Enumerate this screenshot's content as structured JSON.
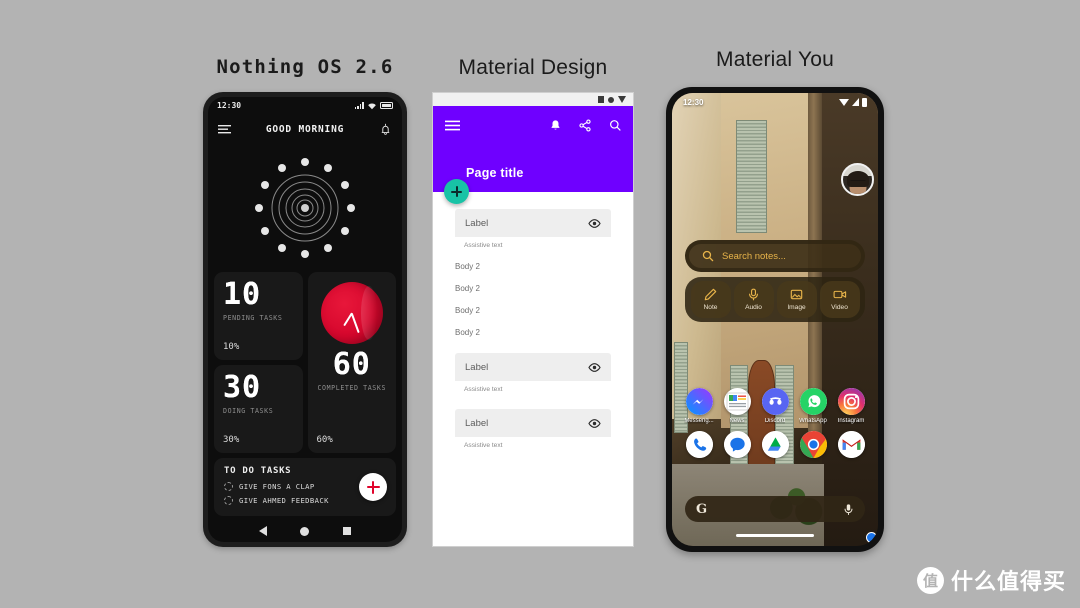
{
  "background_color": "#b3b3b3",
  "columns": [
    {
      "title": "Nothing OS 2.6"
    },
    {
      "title": "Material Design"
    },
    {
      "title": "Material You"
    }
  ],
  "phone_nothing": {
    "status_bar": {
      "time": "12:30",
      "signal_icon": "signal-bars-icon",
      "wifi_icon": "wifi-icon",
      "battery_icon": "battery-icon"
    },
    "header": {
      "menu_icon": "hamburger-menu-icon",
      "title": "GOOD MORNING",
      "bell_icon": "notification-bell-icon"
    },
    "widget": {
      "name": "concentric-dots-widget",
      "dot_count": 12,
      "ring_count": 6
    },
    "cards": [
      {
        "value": "10",
        "caption": "PENDING TASKS",
        "percent": "10%"
      },
      {
        "value": "30",
        "caption": "DOING TASKS",
        "percent": "30%"
      },
      {
        "value": "60",
        "caption": "COMPLETED TASKS",
        "percent": "60%"
      }
    ],
    "clock": {
      "name": "analog-clock-widget",
      "color": "#d5062c"
    },
    "todo": {
      "title": "TO DO TASKS",
      "items": [
        {
          "label": "GIVE FONS A CLAP"
        },
        {
          "label": "GIVE AHMED FEEDBACK"
        }
      ],
      "add_button": "add-task-fab",
      "add_button_color": "#e0032b"
    },
    "nav_bar": {
      "back": "back-icon",
      "home": "home-icon",
      "recents": "recents-icon"
    }
  },
  "phone_material_design": {
    "app_bar": {
      "color": "#6f00ff",
      "menu_icon": "hamburger-menu-icon",
      "bell_icon": "notification-bell-icon",
      "share_icon": "share-icon",
      "search_icon": "search-icon",
      "title": "Page title"
    },
    "fab": {
      "name": "add-fab",
      "color": "#18c3a6",
      "icon": "plus-icon"
    },
    "fields": [
      {
        "label": "Label",
        "assistive": "Assistive text",
        "trailing_icon": "eye-icon"
      },
      {
        "label": "Label",
        "assistive": "Assistive text",
        "trailing_icon": "eye-icon"
      },
      {
        "label": "Label",
        "assistive": "Assistive text",
        "trailing_icon": "eye-icon"
      }
    ],
    "body_lines": [
      "Body 2",
      "Body 2",
      "Body 2",
      "Body 2"
    ]
  },
  "phone_material_you": {
    "status_bar": {
      "time": "12:30",
      "wifi_icon": "wifi-icon",
      "signal_icon": "signal-icon",
      "battery_icon": "battery-icon"
    },
    "bubble": {
      "name": "chat-bubble-avatar",
      "badge_color": "#1a73e8"
    },
    "keep_widget": {
      "search_icon": "search-icon",
      "search_placeholder": "Search notes...",
      "accent_color": "#e8b44a",
      "actions": [
        {
          "label": "Note",
          "icon": "pencil-icon"
        },
        {
          "label": "Audio",
          "icon": "microphone-icon"
        },
        {
          "label": "Image",
          "icon": "image-icon"
        },
        {
          "label": "Video",
          "icon": "video-camera-icon"
        }
      ]
    },
    "app_rows": [
      [
        {
          "label": "Messeng...",
          "icon": "messenger-icon"
        },
        {
          "label": "News",
          "icon": "google-news-icon"
        },
        {
          "label": "Discord",
          "icon": "discord-icon"
        },
        {
          "label": "WhatsApp",
          "icon": "whatsapp-icon"
        },
        {
          "label": "Instagram",
          "icon": "instagram-icon"
        }
      ],
      [
        {
          "label": "",
          "icon": "phone-icon"
        },
        {
          "label": "",
          "icon": "messages-icon"
        },
        {
          "label": "",
          "icon": "google-drive-icon"
        },
        {
          "label": "",
          "icon": "chrome-icon"
        },
        {
          "label": "",
          "icon": "gmail-icon"
        }
      ]
    ],
    "google_search": {
      "logo": "G",
      "mic_icon": "microphone-icon"
    },
    "gesture_bar": "gesture-bar"
  },
  "watermark": {
    "logo_text": "值",
    "text": "什么值得买"
  }
}
